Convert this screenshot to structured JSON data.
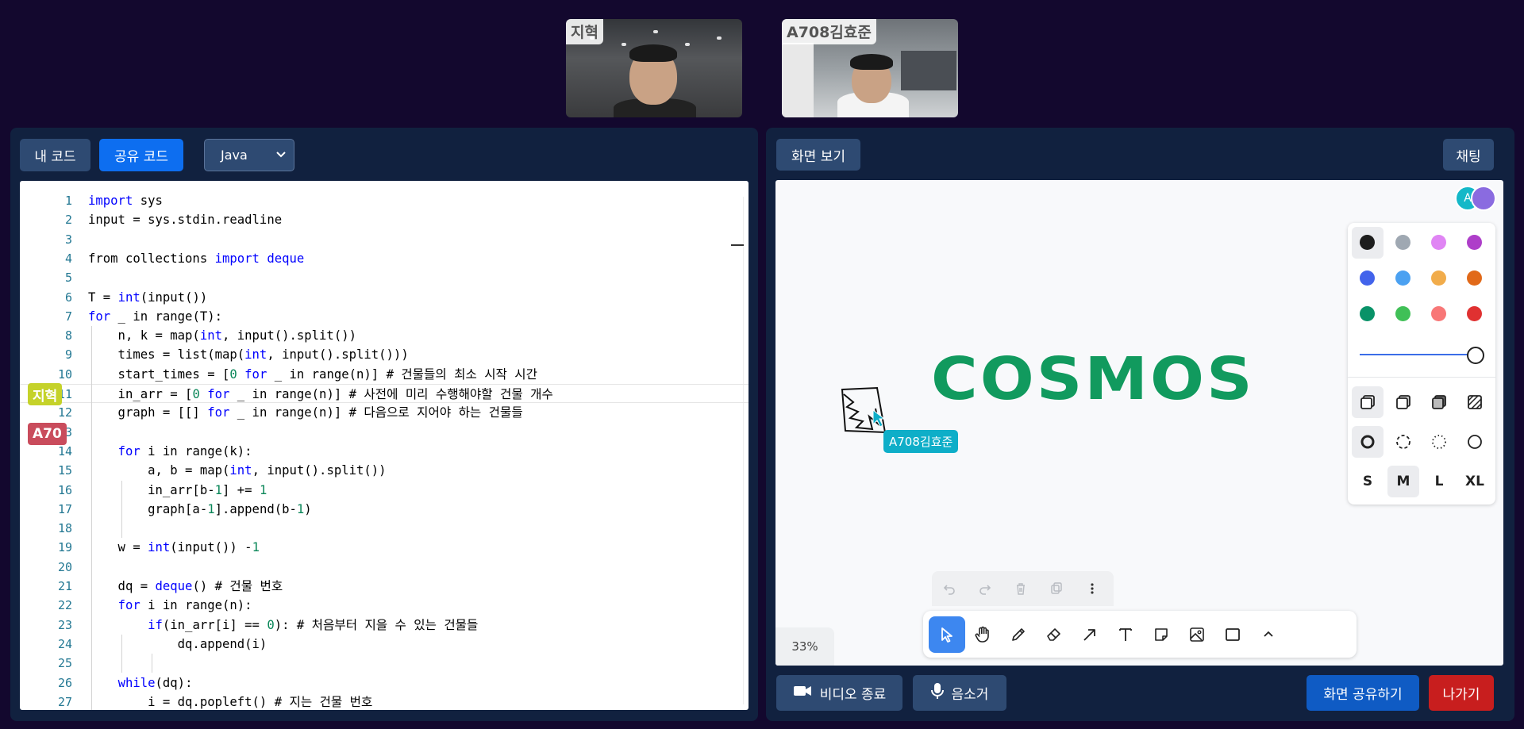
{
  "participants": [
    {
      "name": "지혁"
    },
    {
      "name": "A708김효준"
    }
  ],
  "left_panel": {
    "my_code_label": "내 코드",
    "shared_code_label": "공유 코드",
    "language": "Java",
    "code_lines": [
      {
        "n": "1",
        "text": "import sys"
      },
      {
        "n": "2",
        "text": "input = sys.stdin.readline"
      },
      {
        "n": "3",
        "text": ""
      },
      {
        "n": "4",
        "text": "from collections import deque"
      },
      {
        "n": "5",
        "text": ""
      },
      {
        "n": "6",
        "text": "T = int(input())"
      },
      {
        "n": "7",
        "text": "for _ in range(T):"
      },
      {
        "n": "8",
        "text": "    n, k = map(int, input().split())"
      },
      {
        "n": "9",
        "text": "    times = list(map(int, input().split()))"
      },
      {
        "n": "10",
        "text": "    start_times = [0 for _ in range(n)] # 건물들의 최소 시작 시간"
      },
      {
        "n": "11",
        "text": "    in_arr = [0 for _ in range(n)] # 사전에 미리 수행해야할 건물 개수"
      },
      {
        "n": "12",
        "text": "    graph = [[] for _ in range(n)] # 다음으로 지어야 하는 건물들"
      },
      {
        "n": "13",
        "text": ""
      },
      {
        "n": "14",
        "text": "    for i in range(k):"
      },
      {
        "n": "15",
        "text": "        a, b = map(int, input().split())"
      },
      {
        "n": "16",
        "text": "        in_arr[b-1] += 1"
      },
      {
        "n": "17",
        "text": "        graph[a-1].append(b-1)"
      },
      {
        "n": "18",
        "text": ""
      },
      {
        "n": "19",
        "text": "    w = int(input()) -1"
      },
      {
        "n": "20",
        "text": ""
      },
      {
        "n": "21",
        "text": "    dq = deque() # 건물 번호"
      },
      {
        "n": "22",
        "text": "    for i in range(n):"
      },
      {
        "n": "23",
        "text": "        if(in_arr[i] == 0): # 처음부터 지을 수 있는 건물들"
      },
      {
        "n": "24",
        "text": "            dq.append(i)"
      },
      {
        "n": "25",
        "text": ""
      },
      {
        "n": "26",
        "text": "    while(dq):"
      },
      {
        "n": "27",
        "text": "        i = dq.popleft() # 지는 건물 번호"
      }
    ],
    "user_tags": [
      {
        "label": "지혁",
        "bg": "#c5d22a",
        "color": "#ffffff"
      },
      {
        "label": "A70",
        "bg": "#c94c5c",
        "color": "#ffffff"
      }
    ],
    "video_off_label": "비디오 종료",
    "mute_label": "음소거"
  },
  "right_panel": {
    "screen_view_label": "화면 보기",
    "chat_label": "채팅",
    "board_text": "COSMOS",
    "cursor_user": "A708김효준",
    "avatar_initial": "A",
    "zoom": "33%",
    "colors": [
      "#1d1d1d",
      "#9fa8b2",
      "#e085f4",
      "#ae3ec9",
      "#4263eb",
      "#4ba1f1",
      "#f1ac4b",
      "#e16919",
      "#099268",
      "#40c057",
      "#f87777",
      "#e03131"
    ],
    "sizes": [
      "S",
      "M",
      "L",
      "XL"
    ],
    "selected_size": "M",
    "share_screen_label": "화면 공유하기",
    "leave_label": "나가기"
  }
}
